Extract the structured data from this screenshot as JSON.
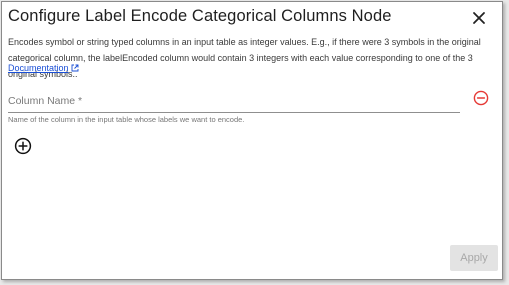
{
  "dialog": {
    "title": "Configure Label Encode Categorical Columns Node",
    "close_icon": "close-icon",
    "description": "Encodes symbol or string typed columns in an input table as integer values. E.g., if there were 3 symbols in the original categorical column, the labelEncoded column would contain 3 integers with each value corresponding to one of the 3 original symbols..",
    "documentation_link": "Documentation",
    "external_link_icon": "external-link-icon"
  },
  "form": {
    "column_name": {
      "placeholder": "Column Name *",
      "value": "",
      "helper_text": "Name of the column in the input table whose labels we want to encode."
    },
    "remove_icon": "remove-circle-icon",
    "add_icon": "add-circle-icon"
  },
  "footer": {
    "apply_label": "Apply"
  },
  "colors": {
    "remove_icon": "#e53935",
    "link": "#1a4fd6",
    "apply_disabled_bg": "#e3e3e3",
    "apply_disabled_text": "#a8a8a8"
  }
}
